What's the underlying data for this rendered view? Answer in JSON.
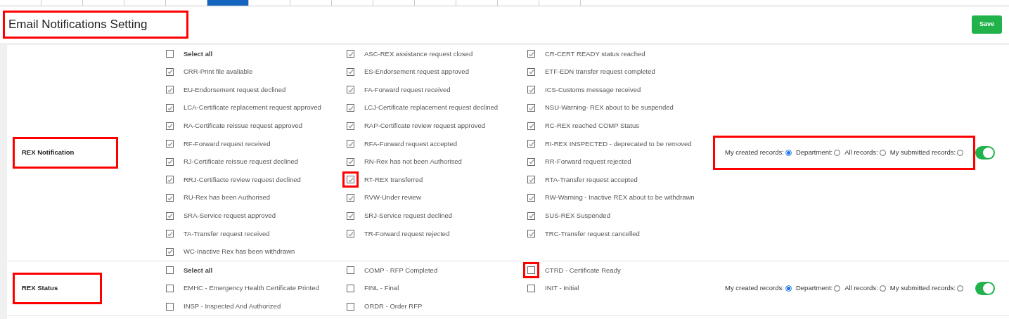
{
  "tabs": [
    {
      "selected": false
    },
    {
      "selected": false
    },
    {
      "selected": false
    },
    {
      "selected": false
    },
    {
      "selected": false
    },
    {
      "selected": true
    },
    {
      "selected": false
    },
    {
      "selected": false
    },
    {
      "selected": false
    },
    {
      "selected": false
    },
    {
      "selected": false
    },
    {
      "selected": false
    },
    {
      "selected": false
    },
    {
      "selected": false
    }
  ],
  "header": {
    "title": "Email Notifications Setting",
    "highlighted": true,
    "save_button": "Save"
  },
  "sections": [
    {
      "label": "REX Notification",
      "highlighted": true,
      "items": [
        {
          "kind": "select_all",
          "label": "Select all",
          "checked": false,
          "highlighted": false
        },
        {
          "kind": "option",
          "label": "ASC-REX assistance request closed",
          "checked": true,
          "highlighted": false
        },
        {
          "kind": "option",
          "label": "CR-CERT READY status reached",
          "checked": true,
          "highlighted": false
        },
        {
          "kind": "option",
          "label": "CRR-Print file avaliable",
          "checked": true,
          "highlighted": false
        },
        {
          "kind": "option",
          "label": "ES-Endorsement request approved",
          "checked": true,
          "highlighted": false
        },
        {
          "kind": "option",
          "label": "ETF-EDN transfer request completed",
          "checked": true,
          "highlighted": false
        },
        {
          "kind": "option",
          "label": "EU-Endorsement request declined",
          "checked": true,
          "highlighted": false
        },
        {
          "kind": "option",
          "label": "FA-Forward request received",
          "checked": true,
          "highlighted": false
        },
        {
          "kind": "option",
          "label": "ICS-Customs message received",
          "checked": true,
          "highlighted": false
        },
        {
          "kind": "option",
          "label": "LCA-Certificate replacement request approved",
          "checked": true,
          "highlighted": false
        },
        {
          "kind": "option",
          "label": "LCJ-Certificate replacement request declined",
          "checked": true,
          "highlighted": false
        },
        {
          "kind": "option",
          "label": "NSU-Warning- REX about to be suspended",
          "checked": true,
          "highlighted": false
        },
        {
          "kind": "option",
          "label": "RA-Certificate reissue request approved",
          "checked": true,
          "highlighted": false
        },
        {
          "kind": "option",
          "label": "RAP-Certificate review request approved",
          "checked": true,
          "highlighted": false
        },
        {
          "kind": "option",
          "label": "RC-REX reached COMP Status",
          "checked": true,
          "highlighted": false
        },
        {
          "kind": "option",
          "label": "RF-Forward request received",
          "checked": true,
          "highlighted": false
        },
        {
          "kind": "option",
          "label": "RFA-Forward request accepted",
          "checked": true,
          "highlighted": false
        },
        {
          "kind": "option",
          "label": "RI-REX INSPECTED - deprecated to be removed",
          "checked": true,
          "highlighted": false
        },
        {
          "kind": "option",
          "label": "RJ-Certificate reissue request declined",
          "checked": true,
          "highlighted": false
        },
        {
          "kind": "option",
          "label": "RN-Rex has not been Authorised",
          "checked": true,
          "highlighted": false
        },
        {
          "kind": "option",
          "label": "RR-Forward request rejected",
          "checked": true,
          "highlighted": false
        },
        {
          "kind": "option",
          "label": "RRJ-Certifiacte review request declined",
          "checked": true,
          "highlighted": false
        },
        {
          "kind": "option",
          "label": "RT-REX transferred",
          "checked": true,
          "highlighted": true
        },
        {
          "kind": "option",
          "label": "RTA-Transfer request accepted",
          "checked": true,
          "highlighted": false
        },
        {
          "kind": "option",
          "label": "RU-Rex has been Authorised",
          "checked": true,
          "highlighted": false
        },
        {
          "kind": "option",
          "label": "RVW-Under review",
          "checked": true,
          "highlighted": false
        },
        {
          "kind": "option",
          "label": "RW-Warning - Inactive REX about to be withdrawn",
          "checked": true,
          "highlighted": false
        },
        {
          "kind": "option",
          "label": "SRA-Service request approved",
          "checked": true,
          "highlighted": false
        },
        {
          "kind": "option",
          "label": "SRJ-Service request declined",
          "checked": true,
          "highlighted": false
        },
        {
          "kind": "option",
          "label": "SUS-REX Suspended",
          "checked": true,
          "highlighted": false
        },
        {
          "kind": "option",
          "label": "TA-Transfer request received",
          "checked": true,
          "highlighted": false
        },
        {
          "kind": "option",
          "label": "TR-Forward request rejected",
          "checked": true,
          "highlighted": false
        },
        {
          "kind": "option",
          "label": "TRC-Transfer request cancelled",
          "checked": true,
          "highlighted": false
        },
        {
          "kind": "option",
          "label": "WC-Inactive Rex has been withdrawn",
          "checked": true,
          "highlighted": false
        }
      ],
      "scope_highlighted": true,
      "scopes": [
        {
          "label": "My created records:",
          "selected": true
        },
        {
          "label": "Department:",
          "selected": false
        },
        {
          "label": "All records:",
          "selected": false
        },
        {
          "label": "My submitted records:",
          "selected": false
        }
      ],
      "enabled": true
    },
    {
      "label": "REX Status",
      "highlighted": true,
      "items": [
        {
          "kind": "select_all",
          "label": "Select all",
          "checked": false,
          "highlighted": false
        },
        {
          "kind": "option",
          "label": "COMP - RFP Completed",
          "checked": false,
          "highlighted": false
        },
        {
          "kind": "option",
          "label": "CTRD - Certificate Ready",
          "checked": false,
          "highlighted": true
        },
        {
          "kind": "option",
          "label": "EMHC - Emergency Health Certificate Printed",
          "checked": false,
          "highlighted": false
        },
        {
          "kind": "option",
          "label": "FINL - Final",
          "checked": false,
          "highlighted": false
        },
        {
          "kind": "option",
          "label": "INIT - Initial",
          "checked": false,
          "highlighted": false
        },
        {
          "kind": "option",
          "label": "INSP - Inspected And Authorized",
          "checked": false,
          "highlighted": false
        },
        {
          "kind": "option",
          "label": "ORDR - Order RFP",
          "checked": false,
          "highlighted": false
        }
      ],
      "scope_highlighted": false,
      "scopes": [
        {
          "label": "My created records:",
          "selected": true
        },
        {
          "label": "Department:",
          "selected": false
        },
        {
          "label": "All records:",
          "selected": false
        },
        {
          "label": "My submitted records:",
          "selected": false
        }
      ],
      "enabled": true
    }
  ]
}
